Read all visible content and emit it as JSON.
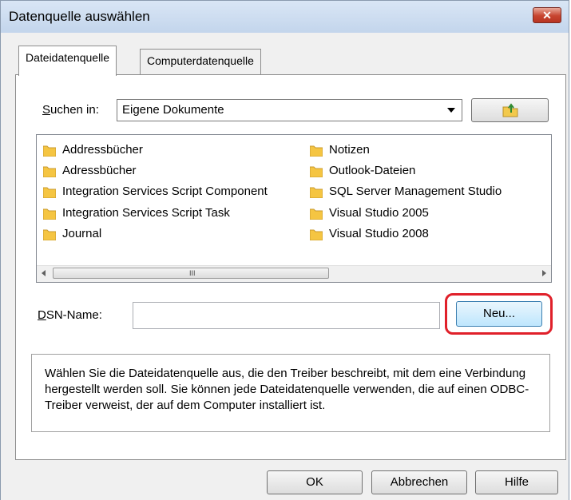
{
  "window": {
    "title": "Datenquelle auswählen",
    "close_glyph": "✕"
  },
  "tabs": [
    {
      "label": "Dateidatenquelle",
      "active": true
    },
    {
      "label": "Computerdatenquelle",
      "active": false
    }
  ],
  "search": {
    "label_accel": "S",
    "label_rest": "uchen in:",
    "value": "Eigene Dokumente"
  },
  "files": {
    "column1": [
      "Addressbücher",
      "Adressbücher",
      "Integration Services Script Component",
      "Integration Services Script Task",
      "Journal"
    ],
    "column2": [
      "Notizen",
      "Outlook-Dateien",
      "SQL Server Management Studio",
      "Visual Studio 2005",
      "Visual Studio 2008"
    ],
    "scroll_grip": "III"
  },
  "dsn": {
    "label_accel": "D",
    "label_rest": "SN-Name:",
    "value": ""
  },
  "buttons": {
    "new": "Neu...",
    "ok": "OK",
    "cancel": "Abbrechen",
    "help": "Hilfe"
  },
  "description": "Wählen Sie die Dateidatenquelle aus, die den Treiber beschreibt, mit dem eine Verbindung hergestellt werden soll. Sie können jede Dateidatenquelle verwenden, die auf einen ODBC-Treiber verweist, der auf dem Computer installiert ist.",
  "colors": {
    "highlight": "#e0202a",
    "folder": "#f5c542"
  },
  "icons": {
    "folder": "folder-icon",
    "up_folder": "up-folder-icon",
    "dropdown": "chevron-down-icon"
  }
}
